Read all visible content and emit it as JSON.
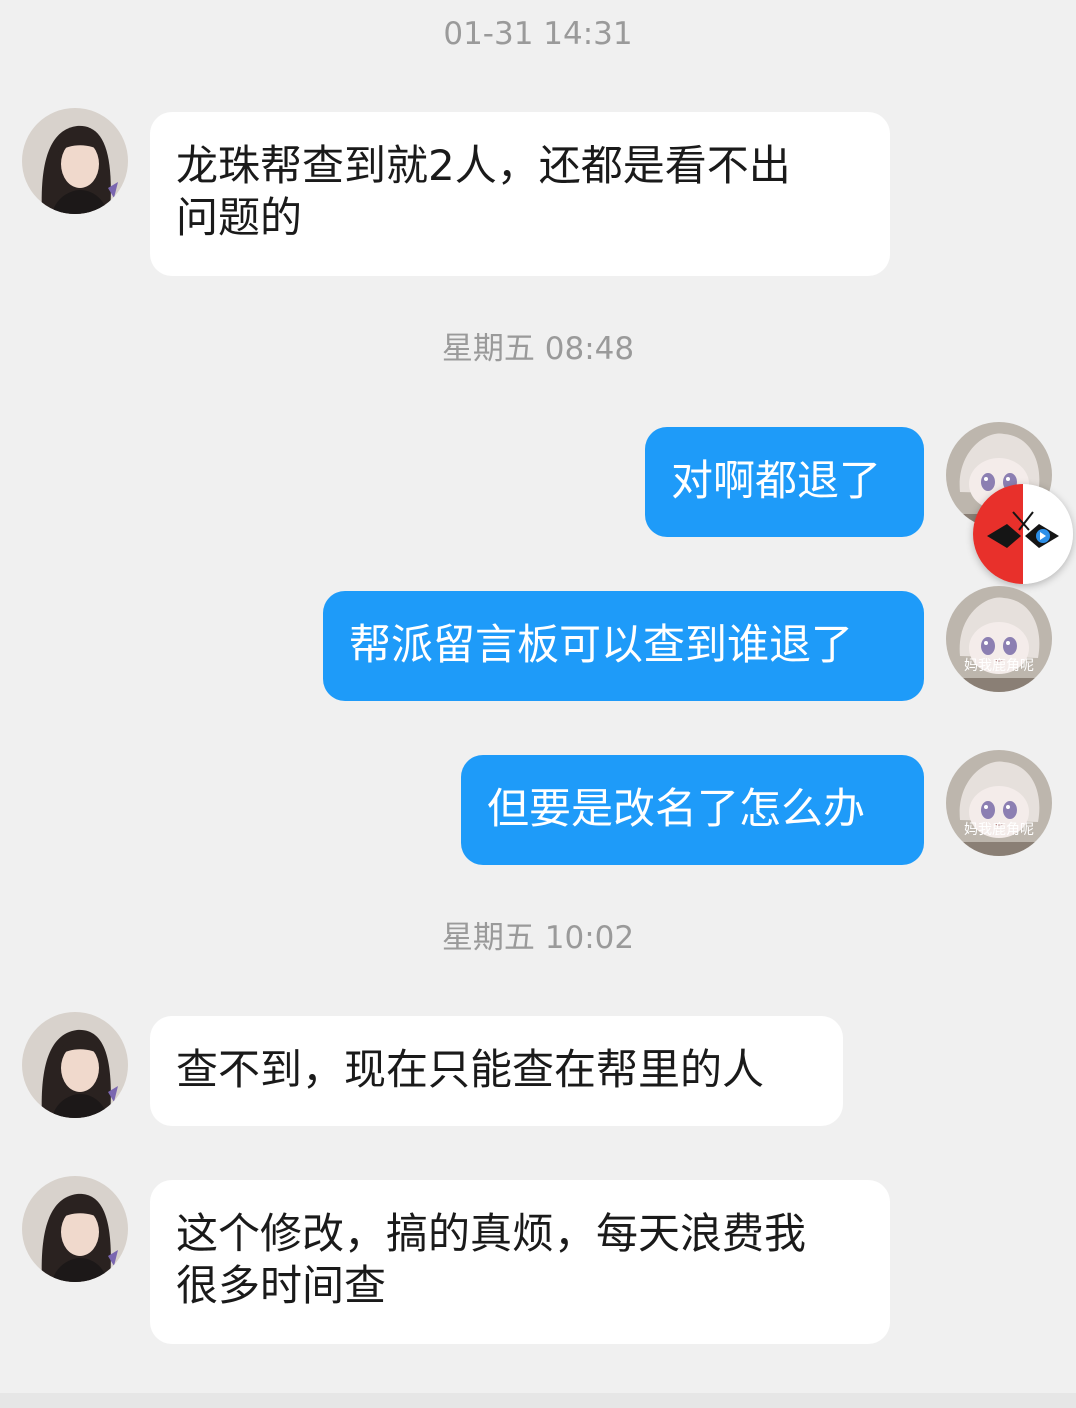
{
  "timestamps": [
    "01-31 14:31",
    "星期五 08:48",
    "星期五 10:02"
  ],
  "messages": [
    {
      "side": "in",
      "lines": [
        "龙珠帮查到就2人，还都是看不出",
        "问题的"
      ]
    },
    {
      "side": "out",
      "text": "对啊都退了"
    },
    {
      "side": "out",
      "text": "帮派留言板可以查到谁退了"
    },
    {
      "side": "out",
      "text": "但要是改名了怎么办"
    },
    {
      "side": "in",
      "text": "查不到，现在只能查在帮里的人"
    },
    {
      "side": "in",
      "lines": [
        "这个修改，搞的真烦，每天浪费我",
        "很多时间查"
      ]
    }
  ],
  "my_avatar_caption": "妈我鹿角呢",
  "colors": {
    "background": "#f0f0f0",
    "incoming_bubble": "#ffffff",
    "outgoing_bubble": "#1e9bf9",
    "timestamp_text": "#9a9a9a"
  },
  "icons": {
    "other_avatar": "girl-portrait-avatar",
    "my_avatar": "plush-doll-avatar",
    "floating_button": "speed-accelerator-icon"
  }
}
